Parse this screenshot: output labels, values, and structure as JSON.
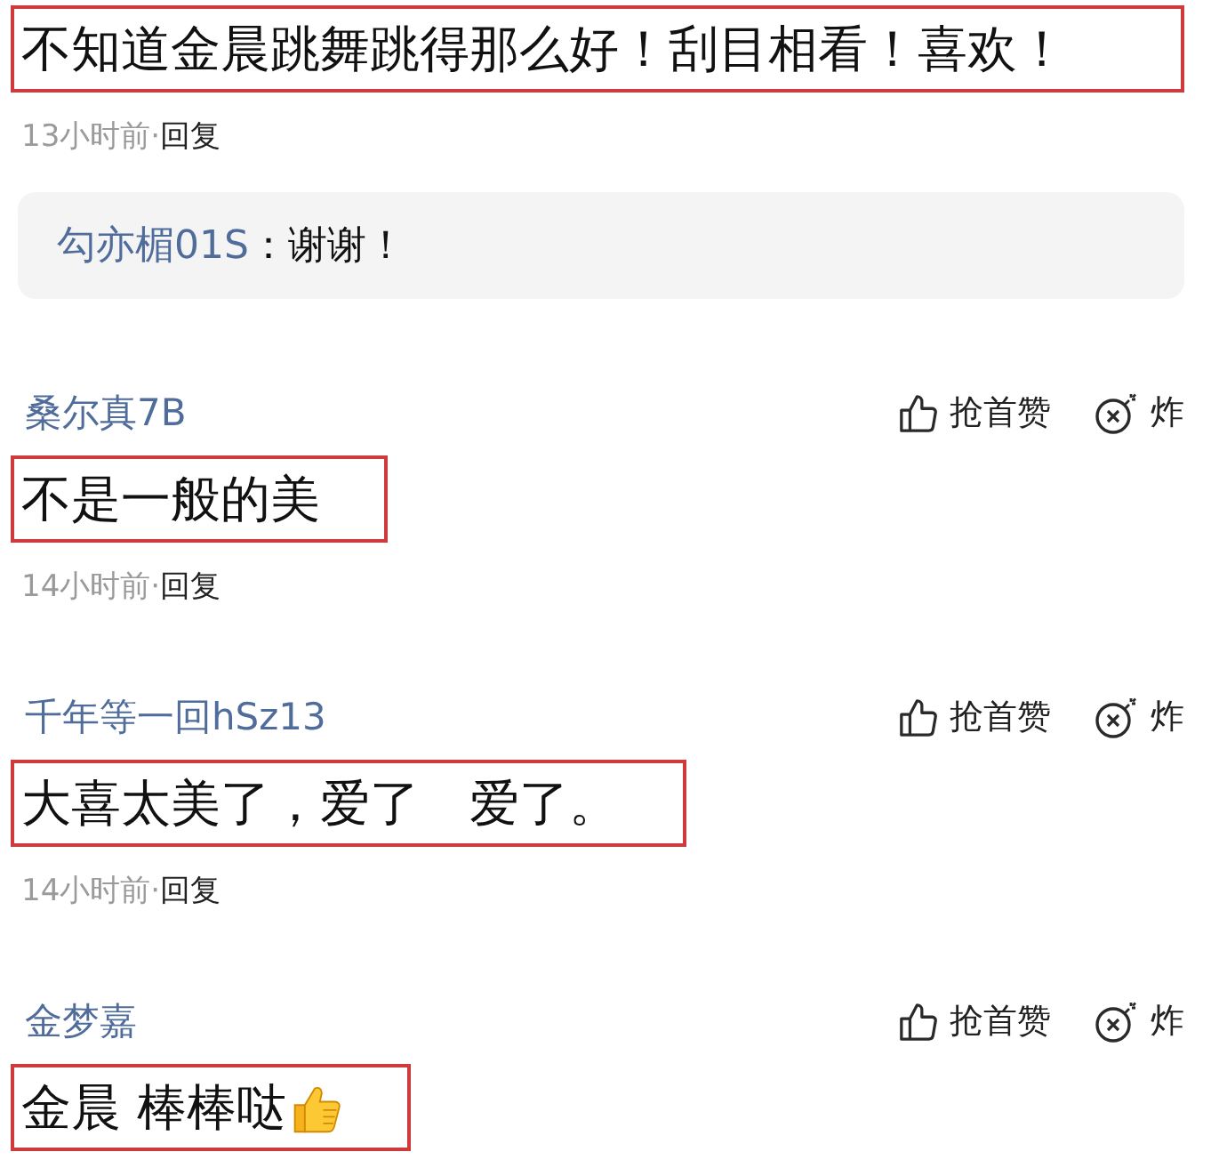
{
  "comments": [
    {
      "text": "不知道金晨跳舞跳得那么好！刮目相看！喜欢！",
      "highlighted": true,
      "time": "13小时前",
      "separator": "·",
      "reply_label": "回复",
      "replies": [
        {
          "author": "勾亦楣01S",
          "text": "：谢谢！"
        }
      ]
    },
    {
      "author": "桑尔真7B",
      "like_label": "抢首赞",
      "bomb_label": "炸",
      "text": "不是一般的美",
      "highlighted": true,
      "time": "14小时前",
      "separator": "·",
      "reply_label": "回复"
    },
    {
      "author": "千年等一回hSz13",
      "like_label": "抢首赞",
      "bomb_label": "炸",
      "text": "大喜太美了，爱了　爱了。",
      "highlighted": true,
      "time": "14小时前",
      "separator": "·",
      "reply_label": "回复"
    },
    {
      "author": "金梦嘉",
      "like_label": "抢首赞",
      "bomb_label": "炸",
      "text": "金晨 棒棒哒",
      "emoji": true,
      "highlighted": true
    }
  ]
}
